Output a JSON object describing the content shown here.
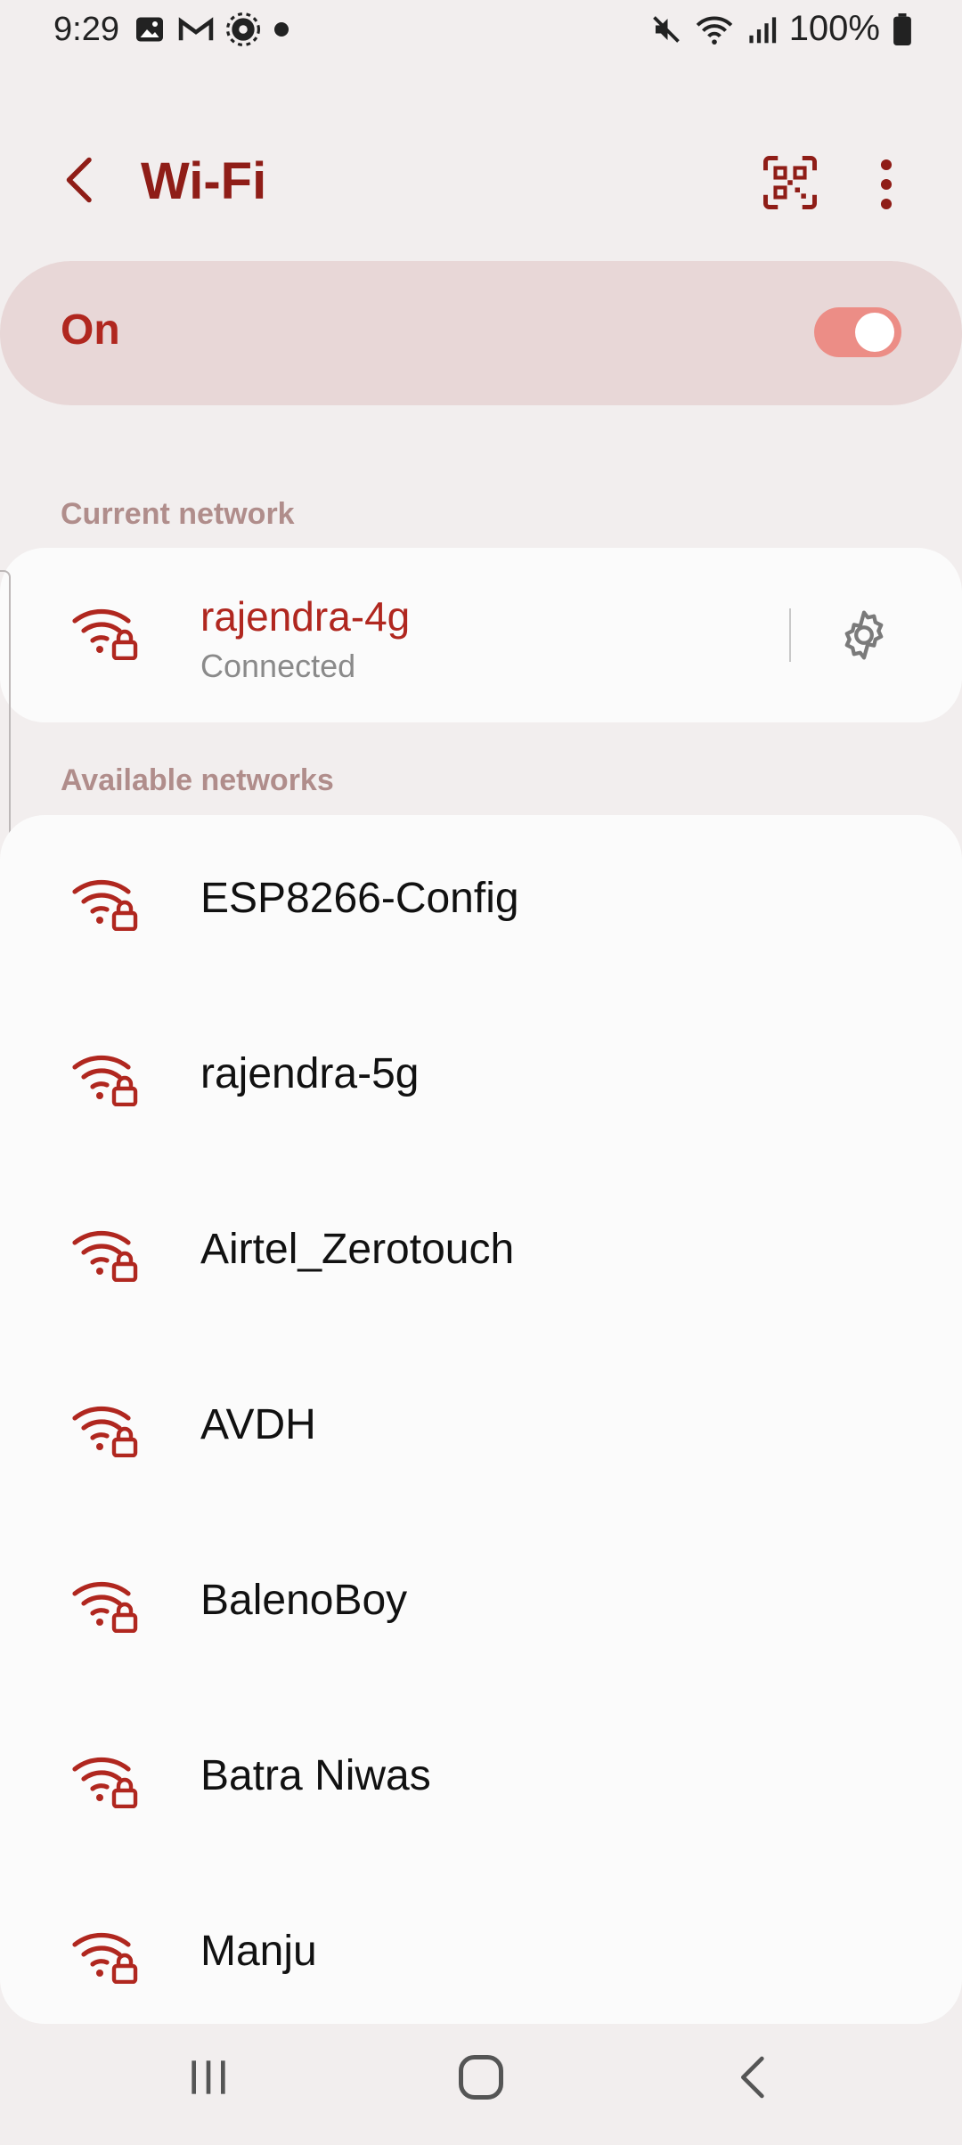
{
  "status_bar": {
    "time": "9:29",
    "battery": "100%",
    "left_icons": [
      "gallery-icon",
      "gmail-icon",
      "settings-gear-icon",
      "dot-icon"
    ],
    "right_icons": [
      "mute-icon",
      "wifi-signal-icon",
      "cell-signal-icon",
      "battery-icon"
    ]
  },
  "header": {
    "title": "Wi-Fi",
    "back_icon": "chevron-left-icon",
    "qr_icon": "qr-scan-icon",
    "more_icon": "more-vert-icon"
  },
  "master_toggle": {
    "label": "On",
    "enabled": true
  },
  "current_network": {
    "section_label": "Current network",
    "name": "rajendra-4g",
    "status": "Connected"
  },
  "available_networks": {
    "section_label": "Available networks",
    "items": [
      {
        "name": "ESP8266-Config"
      },
      {
        "name": "rajendra-5g"
      },
      {
        "name": "Airtel_Zerotouch"
      },
      {
        "name": "AVDH"
      },
      {
        "name": "BalenoBoy"
      },
      {
        "name": "Batra Niwas"
      },
      {
        "name": "Manju"
      }
    ]
  },
  "colors": {
    "accent": "#b0271f",
    "title": "#8f1d17",
    "toggle_track": "#ec8d86",
    "background": "#f2eeee",
    "card": "#fbfbfb",
    "master_card": "#e8d7d7",
    "section_header": "#b08d8b"
  }
}
